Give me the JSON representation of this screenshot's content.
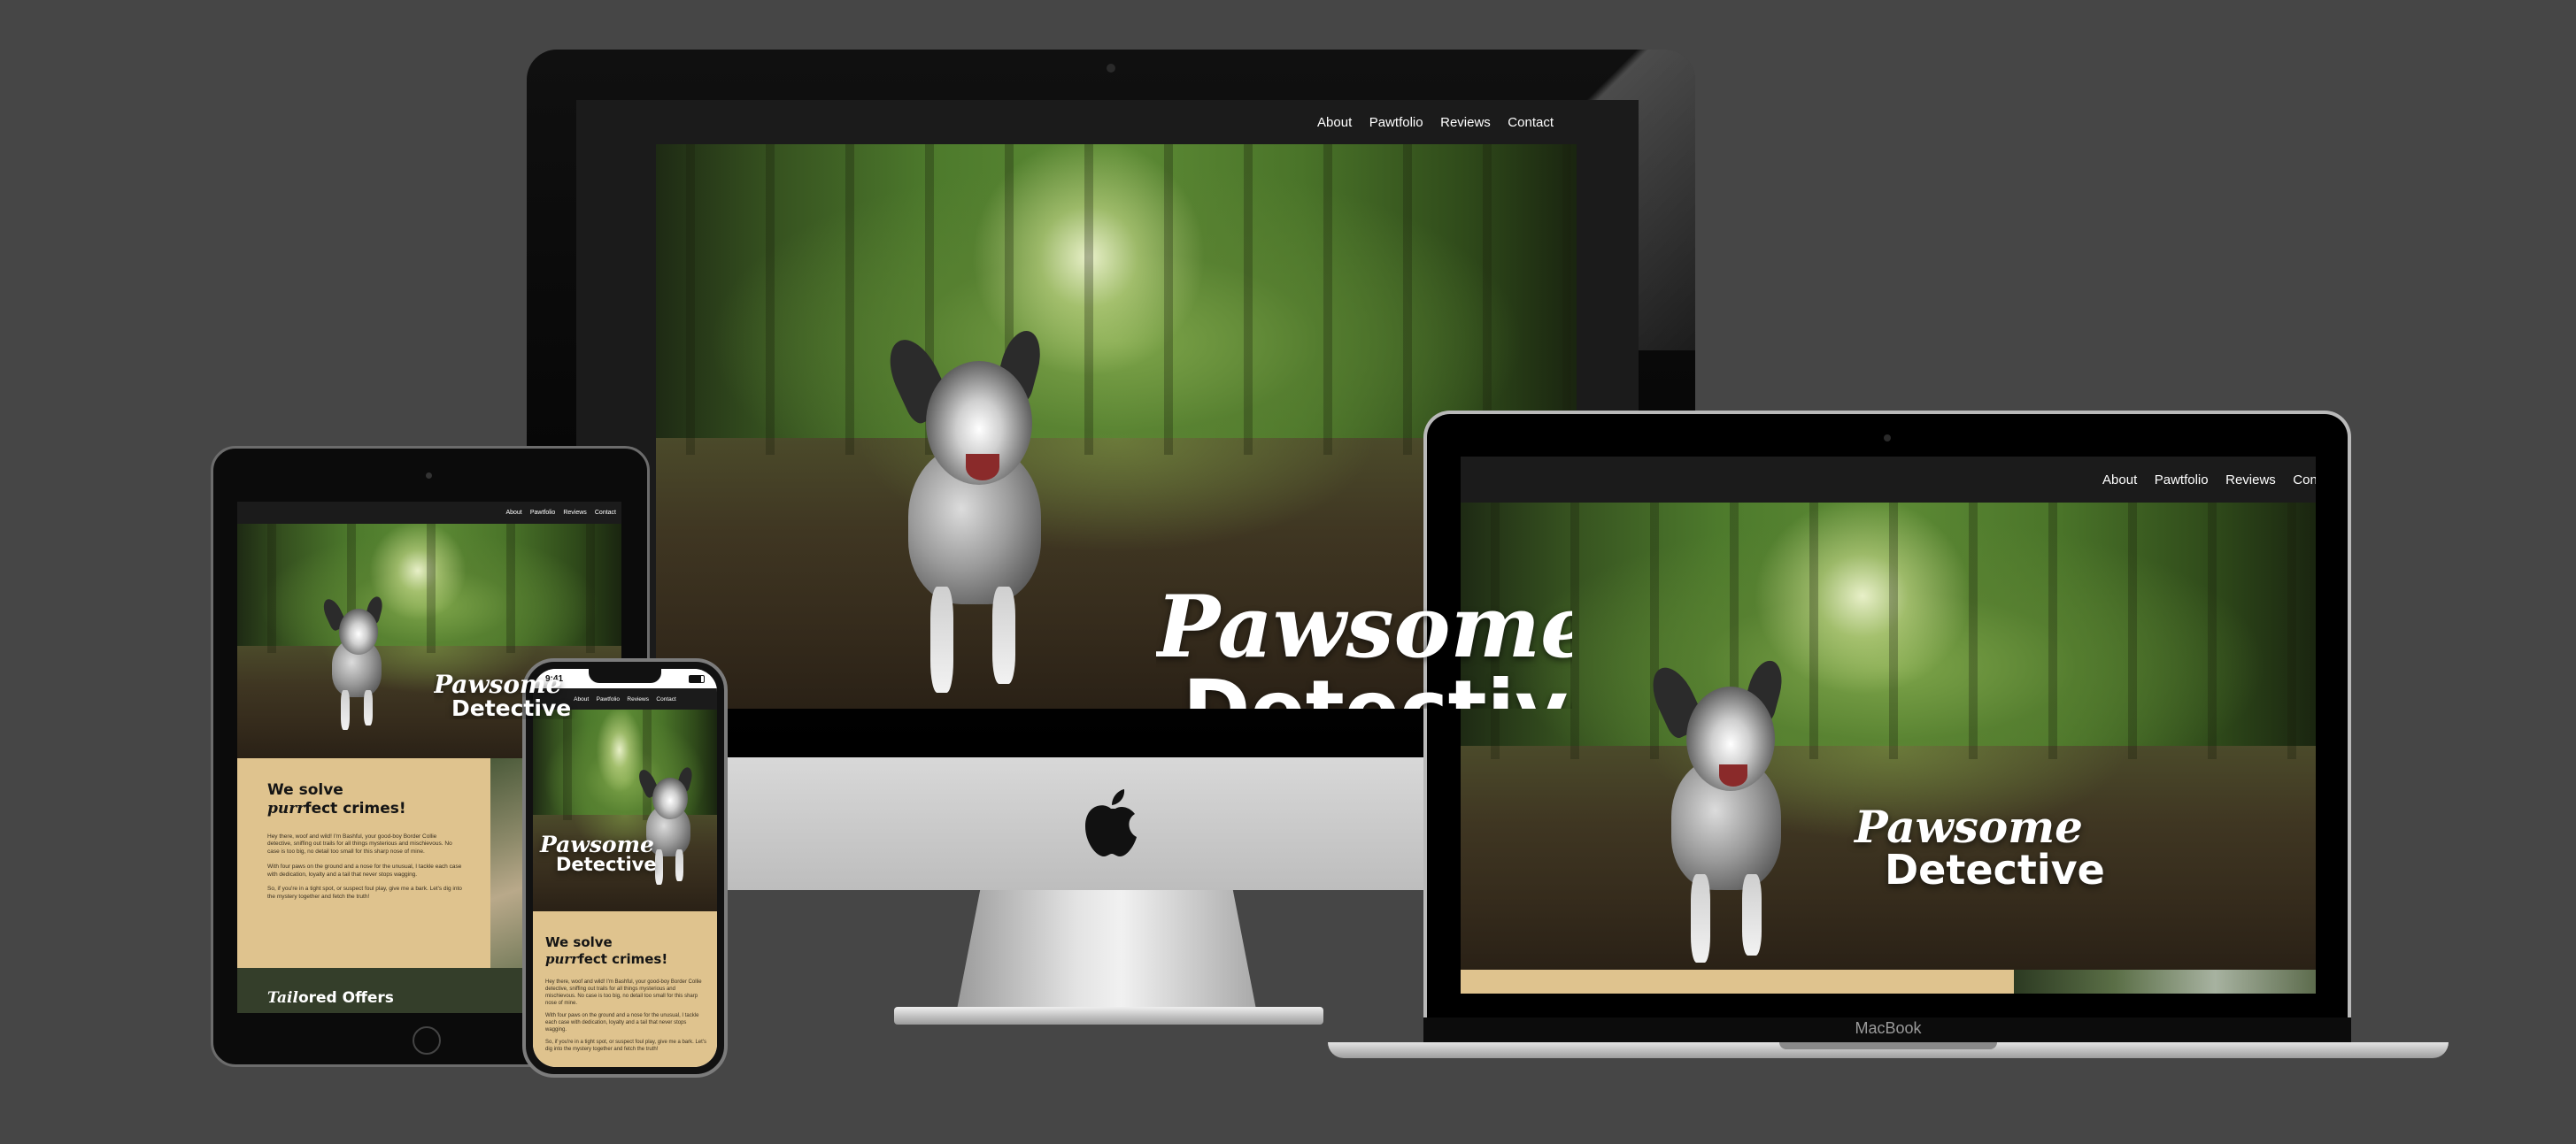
{
  "site": {
    "nav": [
      "About",
      "Pawtfolio",
      "Reviews",
      "Contact"
    ],
    "hero_line1": "Pawsome",
    "hero_line2": "Detective",
    "tag_line1": "We solve",
    "tag_italic": "purr",
    "tag_rest": "fect crimes!",
    "offers_italic": "Tail",
    "offers_rest": "ored Offers",
    "para1": "Hey there, woof and wild! I'm Bashful, your good-boy Border Collie detective, sniffing out trails for all things mysterious and mischievous. No case is too big, no detail too small for this sharp nose of mine.",
    "para2": "With four paws on the ground and a nose for the unusual, I tackle each case with dedication, loyalty and a tail that never stops wagging.",
    "para3": "So, if you're in a tight spot, or suspect foul play, give me a bark. Let's dig into the mystery together and fetch the truth!"
  },
  "devices": {
    "macbook_label": "MacBook",
    "phone_time": "9:41"
  },
  "colors": {
    "background": "#464646",
    "nav": "#1b1b1b",
    "tan": "#dfc38e",
    "olive": "#343e2a"
  }
}
